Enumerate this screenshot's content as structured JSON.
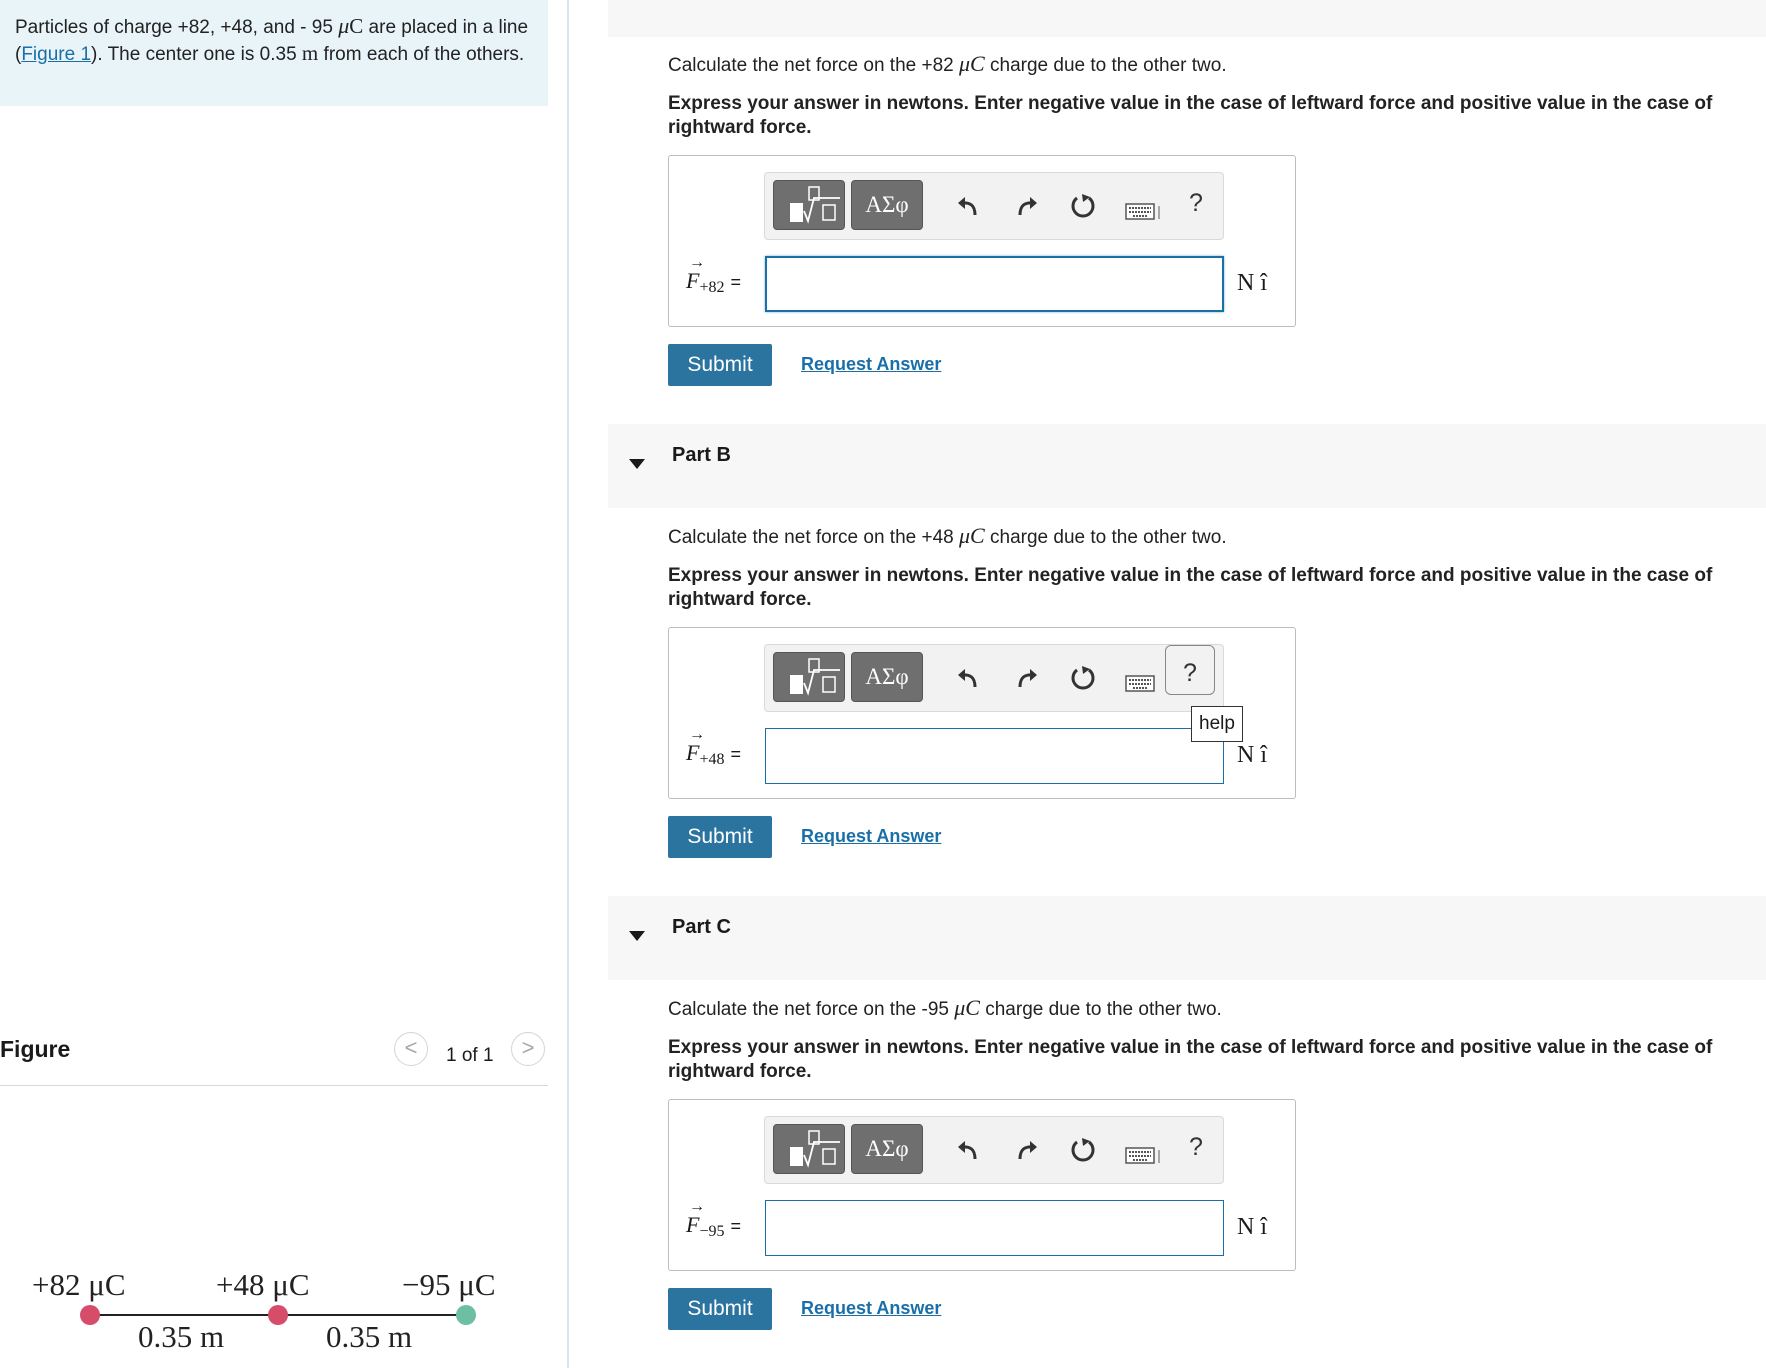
{
  "intro": {
    "text_pre": "Particles of charge +82, +48, and - 95 ",
    "unit_mu": "μ",
    "unit_c": "C",
    "text_mid": " are placed in a line (",
    "figure_link": "Figure 1",
    "text_mid2": "). The center one is 0.35 ",
    "unit_m": "m",
    "text_post": " from each of the others."
  },
  "figure": {
    "title": "Figure",
    "pager": "1 of 1",
    "prev": "<",
    "next": ">",
    "charges": [
      "+82 μC",
      "+48 μC",
      "−95 μC"
    ],
    "distances": [
      "0.35 m",
      "0.35 m"
    ],
    "colors": {
      "positive": "#d64d6a",
      "negative": "#6cbfa2",
      "line": "#222222"
    }
  },
  "partA": {
    "question_pre": "Calculate the net force on the +82 ",
    "question_unit": "μC",
    "question_post": " charge due to the other two.",
    "instructions": "Express your answer in newtons. Enter negative value in the case of leftward force and positive value in the case of rightward force.",
    "var": "F",
    "var_sub": "+82",
    "eq": "=",
    "value": "",
    "unit": "N î"
  },
  "partB": {
    "title": "Part B",
    "question_pre": "Calculate the net force on the +48 ",
    "question_unit": "μC",
    "question_post": " charge due to the other two.",
    "instructions": "Express your answer in newtons. Enter negative value in the case of leftward force and positive value in the case of rightward force.",
    "var": "F",
    "var_sub": "+48",
    "eq": "=",
    "value": "",
    "unit": "N î",
    "tooltip": "help"
  },
  "partC": {
    "title": "Part C",
    "question_pre": "Calculate the net force on the -95 ",
    "question_unit": "μC",
    "question_post": " charge due to the other two.",
    "instructions": "Express your answer in newtons. Enter negative value in the case of leftward force and positive value in the case of rightward force.",
    "var": "F",
    "var_sub": "−95",
    "eq": "=",
    "value": "",
    "unit": "N î"
  },
  "toolbar": {
    "greek_label": "ΑΣφ",
    "help_label": "?",
    "icons": [
      "templates-icon",
      "greek-symbols-icon",
      "undo-icon",
      "redo-icon",
      "reset-icon",
      "keyboard-icon",
      "help-icon"
    ]
  },
  "buttons": {
    "submit": "Submit",
    "request_answer": "Request Answer"
  },
  "colors": {
    "accent": "#2b74a0",
    "link": "#1b6fa8",
    "intro_bg": "#e8f4f8",
    "band_bg": "#f7f7f7"
  }
}
